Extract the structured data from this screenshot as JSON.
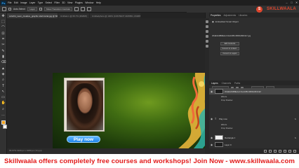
{
  "menubar": {
    "logo": "Ps",
    "items": [
      "File",
      "Edit",
      "Image",
      "Layer",
      "Type",
      "Select",
      "Filter",
      "3D",
      "View",
      "Plugins",
      "Window",
      "Help"
    ],
    "window_controls": [
      "–",
      "□",
      "✕"
    ]
  },
  "options": {
    "auto_select_label": "Auto-Select:",
    "target": "Layer",
    "show_transform_controls": "Show Transform Controls"
  },
  "brand": {
    "mark": "S",
    "name_part1": "SKILL",
    "name_part2": "WAALA",
    "color": "#e0462d"
  },
  "tabs": [
    {
      "label": "colorful_neon_creative_graphic-Horizontal.jpg @ 66.7% (WHE3A9B8EdorC3e1DBC4B93AB4CE7, RGB/8) *",
      "active": true
    },
    {
      "label": "Untitled-1 @ 66.7% (RGB/8)",
      "active": false
    },
    {
      "label": "Untitledphoto @ 100% (CONTENT 4015651, RGB/8)",
      "active": false
    }
  ],
  "tools": [
    "✥",
    "⬚",
    "⌒",
    "⊡",
    "⌗",
    "✂",
    "✎",
    "▮",
    "⌫",
    "▲",
    "◈",
    "⌕",
    "T",
    "↖",
    "▭",
    "✋",
    "⌕",
    "…"
  ],
  "artboard": {
    "play_button_label": "Play now"
  },
  "status": "66.67%   1920 px x 1080 px (72 ppi)",
  "panel_tabs": [
    "Properties",
    "Adjustments",
    "Libraries"
  ],
  "properties": {
    "header": "Embedded Smart Object",
    "file_name": "WHE3A9B8EdorC3e1DBC4B93AB4CE7.jpg",
    "buttons": [
      "Edit Contents",
      "Convert to Linked...",
      "Convert to Layers"
    ]
  },
  "layers_tabs": [
    "Layers",
    "Channels",
    "Paths"
  ],
  "layers": [
    {
      "name": "WHE3A9B8EdorC3e1DBC4B93AB4CE7",
      "fx": "",
      "selected": true,
      "thumb": "dark"
    },
    {
      "name": "Effects",
      "fx": "",
      "selected": false,
      "thumb": "none"
    },
    {
      "name": "Play now",
      "fx": "fx",
      "selected": false,
      "thumb": "text"
    },
    {
      "name": "Effects",
      "fx": "",
      "selected": false,
      "thumb": "none"
    },
    {
      "name": "Rectangle 1",
      "fx": "fx",
      "selected": false,
      "thumb": "white"
    },
    {
      "name": "Layer 0",
      "fx": "",
      "selected": false,
      "thumb": "dark"
    }
  ],
  "layer_sub": {
    "effects_1": "Effects",
    "drop_shadow_1": "Drop Shadow",
    "effects_2": "Effects",
    "drop_shadow_2": "Drop Shadow"
  },
  "banner": {
    "text": "Skillwaala offers completely free courses and workshops! Join Now - www.skillwaala.com",
    "color": "#e21c1c"
  }
}
